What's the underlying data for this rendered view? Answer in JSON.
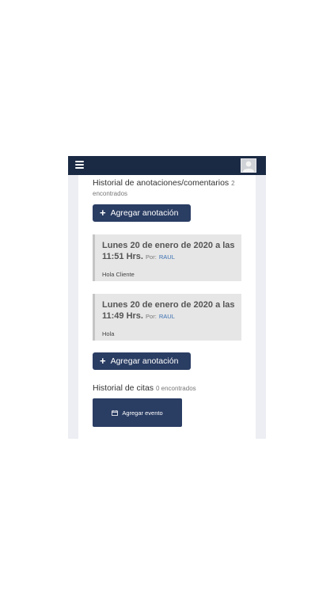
{
  "navbar": {
    "menu_icon": "hamburger-menu-icon",
    "avatar_icon": "user-avatar-icon"
  },
  "annotations": {
    "title": "Historial de anotaciones/comentarios",
    "count_number": "2",
    "count_label": "encontrados",
    "add_button_label": "Agregar anotación",
    "by_label": "Por:",
    "items": [
      {
        "date_line1": "Lunes 20 de enero de 2020 a las",
        "date_line2": "11:51 Hrs.",
        "author": "RAUL",
        "text": "Hola Cliente"
      },
      {
        "date_line1": "Lunes 20 de enero de 2020 a las",
        "date_line2": "11:49 Hrs.",
        "author": "RAUL",
        "text": "Hola"
      }
    ]
  },
  "appointments": {
    "title": "Historial de citas",
    "count": "0 encontrados",
    "add_event_label": "Agregar evento",
    "add_event_icon": "calendar-icon"
  },
  "colors": {
    "navbar": "#1b2a44",
    "button": "#2a3d63",
    "card": "#e6e6e6",
    "link": "#3a6fb0"
  }
}
